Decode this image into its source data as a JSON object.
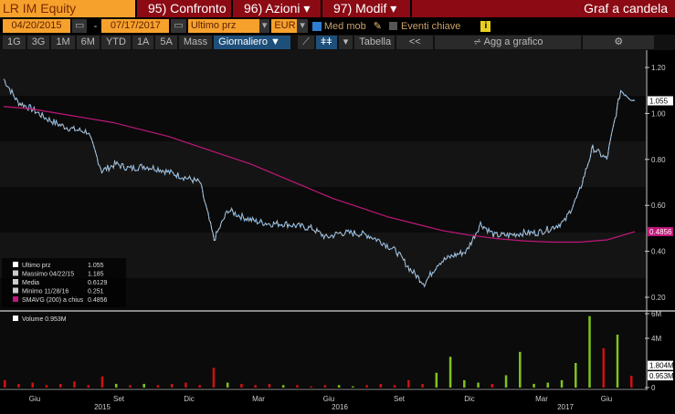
{
  "header": {
    "ticker": "LR IM Equity",
    "confronto": "95) Confronto",
    "azioni": "96) Azioni",
    "modif": "97) Modif",
    "title": "Graf a candela"
  },
  "controls": {
    "start_date": "04/20/2015",
    "dash": "-",
    "end_date": "07/17/2017",
    "field": "Ultimo prz",
    "currency": "EUR",
    "moving_avg": "Med mob",
    "key_events": "Eventi chiave",
    "info": "i"
  },
  "toolbar": {
    "periods": [
      "1G",
      "3G",
      "1M",
      "6M",
      "YTD",
      "1A",
      "5A",
      "Mass"
    ],
    "frequency": "Giornaliero ▼",
    "table": "Tabella",
    "collapse": "<<",
    "add_to_chart": "Agg a grafico"
  },
  "legend": [
    {
      "label": "Ultimo prz",
      "value": "1.055"
    },
    {
      "label": "Massimo 04/22/15",
      "value": "1.185"
    },
    {
      "label": "Media",
      "value": "0.6129"
    },
    {
      "label": "Minimo 11/28/16",
      "value": "0.251"
    },
    {
      "label": "SMAVG (200) a chius",
      "value": "0.4856"
    }
  ],
  "volume_legend": "Volume 0.953M",
  "colors": {
    "price": "#6fa8dc",
    "sma": "#c0177a",
    "vol_up": "#7fc31c",
    "vol_down": "#d01010"
  },
  "chart_data": {
    "type": "line",
    "price_axis": {
      "ticks": [
        "1.20",
        "1.00",
        "0.80",
        "0.60",
        "0.40",
        "0.20"
      ],
      "ylim": [
        0.17,
        1.27
      ]
    },
    "volume_axis": {
      "ticks": [
        "6M",
        "4M",
        "0"
      ],
      "ylim": [
        0,
        6.5
      ]
    },
    "last_labels": {
      "price": "1.055",
      "sma": "0.4856",
      "vol_avg": "1.804M",
      "vol": "0.953M"
    },
    "x_months": [
      "Giu",
      "Set",
      "Dic",
      "Mar",
      "Giu",
      "Set",
      "Dic",
      "Mar",
      "Giu"
    ],
    "x_years": [
      "2015",
      "2016",
      "2017"
    ],
    "price": [
      1.15,
      1.05,
      1.02,
      0.98,
      0.95,
      0.93,
      0.92,
      0.75,
      0.78,
      0.76,
      0.77,
      0.76,
      0.74,
      0.72,
      0.7,
      0.45,
      0.58,
      0.55,
      0.53,
      0.52,
      0.52,
      0.51,
      0.5,
      0.46,
      0.48,
      0.48,
      0.47,
      0.44,
      0.4,
      0.32,
      0.26,
      0.35,
      0.38,
      0.4,
      0.52,
      0.47,
      0.47,
      0.48,
      0.48,
      0.5,
      0.53,
      0.65,
      0.85,
      0.8,
      1.1,
      1.055
    ],
    "sma": [
      1.03,
      1.02,
      1.0,
      0.98,
      0.96,
      0.93,
      0.9,
      0.86,
      0.82,
      0.78,
      0.73,
      0.68,
      0.63,
      0.59,
      0.55,
      0.52,
      0.49,
      0.47,
      0.455,
      0.445,
      0.44,
      0.44,
      0.45,
      0.4856
    ],
    "volume": [
      0.6,
      0.3,
      0.4,
      0.2,
      0.3,
      0.5,
      0.2,
      0.9,
      0.3,
      0.2,
      0.3,
      0.2,
      0.3,
      0.4,
      0.2,
      1.6,
      0.4,
      0.3,
      0.2,
      0.3,
      0.2,
      0.2,
      0.1,
      0.2,
      0.2,
      0.1,
      0.2,
      0.3,
      0.2,
      0.6,
      0.3,
      1.2,
      2.5,
      0.6,
      0.4,
      0.3,
      1.0,
      2.9,
      0.3,
      0.4,
      0.6,
      2.0,
      5.8,
      3.2,
      4.3,
      0.953
    ]
  }
}
